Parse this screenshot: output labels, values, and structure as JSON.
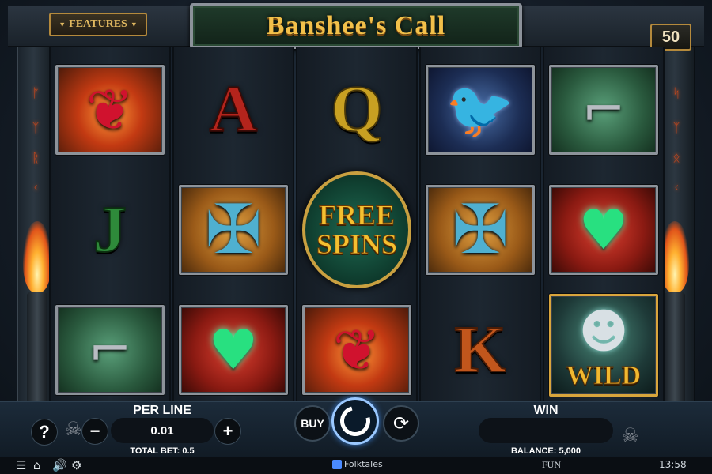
{
  "header": {
    "features_label": "FEATURES",
    "title": "Banshee's Call",
    "lines": "50"
  },
  "reels": [
    [
      {
        "symbol": "rose-icon",
        "kind": "image"
      },
      {
        "symbol": "J",
        "kind": "letter"
      },
      {
        "symbol": "pistol-icon",
        "kind": "image"
      }
    ],
    [
      {
        "symbol": "A",
        "kind": "letter"
      },
      {
        "symbol": "celtic-cross-icon",
        "kind": "image"
      },
      {
        "symbol": "claddagh-ring-icon",
        "kind": "image"
      }
    ],
    [
      {
        "symbol": "Q",
        "kind": "letter"
      },
      {
        "symbol": "free-spins",
        "kind": "scatter"
      },
      {
        "symbol": "rose-icon",
        "kind": "image"
      }
    ],
    [
      {
        "symbol": "raven-icon",
        "kind": "image"
      },
      {
        "symbol": "celtic-cross-icon",
        "kind": "image"
      },
      {
        "symbol": "K",
        "kind": "letter"
      }
    ],
    [
      {
        "symbol": "pistol-icon",
        "kind": "image"
      },
      {
        "symbol": "claddagh-ring-icon",
        "kind": "image"
      },
      {
        "symbol": "wild",
        "kind": "wild"
      }
    ]
  ],
  "symbols": {
    "letter_A": "A",
    "letter_Q": "Q",
    "letter_J": "J",
    "letter_K": "K",
    "free_spins_line1": "FREE",
    "free_spins_line2": "SPINS",
    "wild_label": "WILD"
  },
  "controls": {
    "help": "?",
    "per_line_label": "PER LINE",
    "per_line_value": "0.01",
    "minus": "−",
    "plus": "+",
    "total_bet": "TOTAL BET: 0.5",
    "buy_label": "BUY",
    "win_label": "WIN",
    "win_value": "",
    "balance": "BALANCE: 5,000"
  },
  "system_bar": {
    "provider": "Folktales",
    "mode": "FUN",
    "time": "13:58"
  },
  "colors": {
    "title_gold": "#f2c04a",
    "accent_blue": "#9ac8ff",
    "frame_silver": "#8d939a"
  }
}
